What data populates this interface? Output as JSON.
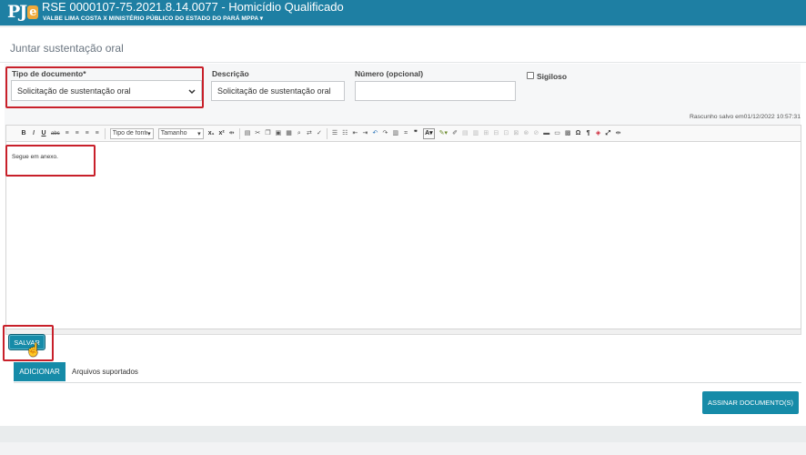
{
  "header": {
    "logo_text": "PJ",
    "logo_accent": "e",
    "process_title": "RSE 0000107-75.2021.8.14.0077 - Homicídio Qualificado",
    "parties": "VALBE LIMA COSTA X MINISTÉRIO PÚBLICO DO ESTADO DO PARÁ MPPA",
    "parties_caret": "▾"
  },
  "page": {
    "title": "Juntar sustentação oral"
  },
  "form": {
    "tipo_label": "Tipo de documento*",
    "tipo_value": "Solicitação de sustentação oral",
    "descricao_label": "Descrição",
    "descricao_value": "Solicitação de sustentação oral",
    "numero_label": "Número (opcional)",
    "numero_value": "",
    "sigiloso_label": "Sigiloso"
  },
  "autosave": "Rascunho salvo em01/12/2022 10:57:31",
  "toolbar": {
    "bold": "B",
    "italic": "I",
    "underline": "U",
    "strike": "abc",
    "font_type": "Tipo de fonte",
    "font_size": "Tamanho",
    "subscript": "x₁",
    "superscript": "x²",
    "quote": "❞",
    "omega": "Ω",
    "pilcrow": "¶"
  },
  "editor": {
    "content": "Segue em anexo."
  },
  "buttons": {
    "salvar": "SALVAR",
    "adicionar": "ADICIONAR",
    "arquivos": "Arquivos suportados",
    "assinar": "ASSINAR DOCUMENTO(S)"
  },
  "colors": {
    "header": "#1e7fa3",
    "button": "#168ba8",
    "highlight": "#c8202a"
  }
}
